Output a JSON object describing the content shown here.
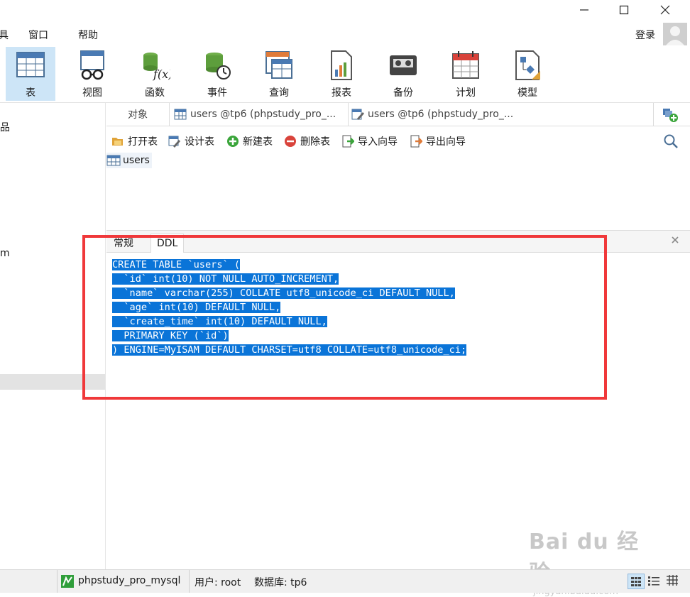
{
  "window": {
    "controls": [
      "minimize",
      "maximize",
      "close"
    ]
  },
  "menu": {
    "items": [
      "具",
      "窗口",
      "帮助"
    ],
    "login": "登录"
  },
  "ribbon": {
    "buttons": [
      {
        "label": "表",
        "icon": "table-icon",
        "active": true
      },
      {
        "label": "视图",
        "icon": "view-icon"
      },
      {
        "label": "函数",
        "icon": "function-icon"
      },
      {
        "label": "事件",
        "icon": "event-icon"
      },
      {
        "label": "查询",
        "icon": "query-icon"
      },
      {
        "label": "报表",
        "icon": "report-icon"
      },
      {
        "label": "备份",
        "icon": "backup-icon"
      },
      {
        "label": "计划",
        "icon": "schedule-icon"
      },
      {
        "label": "模型",
        "icon": "model-icon"
      }
    ]
  },
  "leftnav": {
    "items": [
      "品",
      "m"
    ]
  },
  "objtabs": {
    "object_label": "对象",
    "tab1": "users @tp6 (phpstudy_pro_...",
    "tab2": "users @tp6 (phpstudy_pro_..."
  },
  "toolbar": {
    "items": [
      "打开表",
      "设计表",
      "新建表",
      "删除表",
      "导入向导",
      "导出向导"
    ]
  },
  "objects": {
    "table_name": "users"
  },
  "ddl": {
    "tabs": [
      "常规",
      "DDL"
    ],
    "lines": [
      "CREATE TABLE `users` (",
      "  `id` int(10) NOT NULL AUTO_INCREMENT,",
      "  `name` varchar(255) COLLATE utf8_unicode_ci DEFAULT NULL,",
      "  `age` int(10) DEFAULT NULL,",
      "  `create_time` int(10) DEFAULT NULL,",
      "  PRIMARY KEY (`id`)",
      ") ENGINE=MyISAM DEFAULT CHARSET=utf8 COLLATE=utf8_unicode_ci;"
    ]
  },
  "statusbar": {
    "connection": "phpstudy_pro_mysql",
    "user": "用户: root",
    "database": "数据库: tp6"
  },
  "watermark": {
    "text": "Bai du 经验",
    "sub": "jingyan.baidu.com"
  },
  "colors": {
    "selection": "#0a74d8",
    "highlight_box": "#f0383a",
    "active_button": "#cde5f7"
  }
}
